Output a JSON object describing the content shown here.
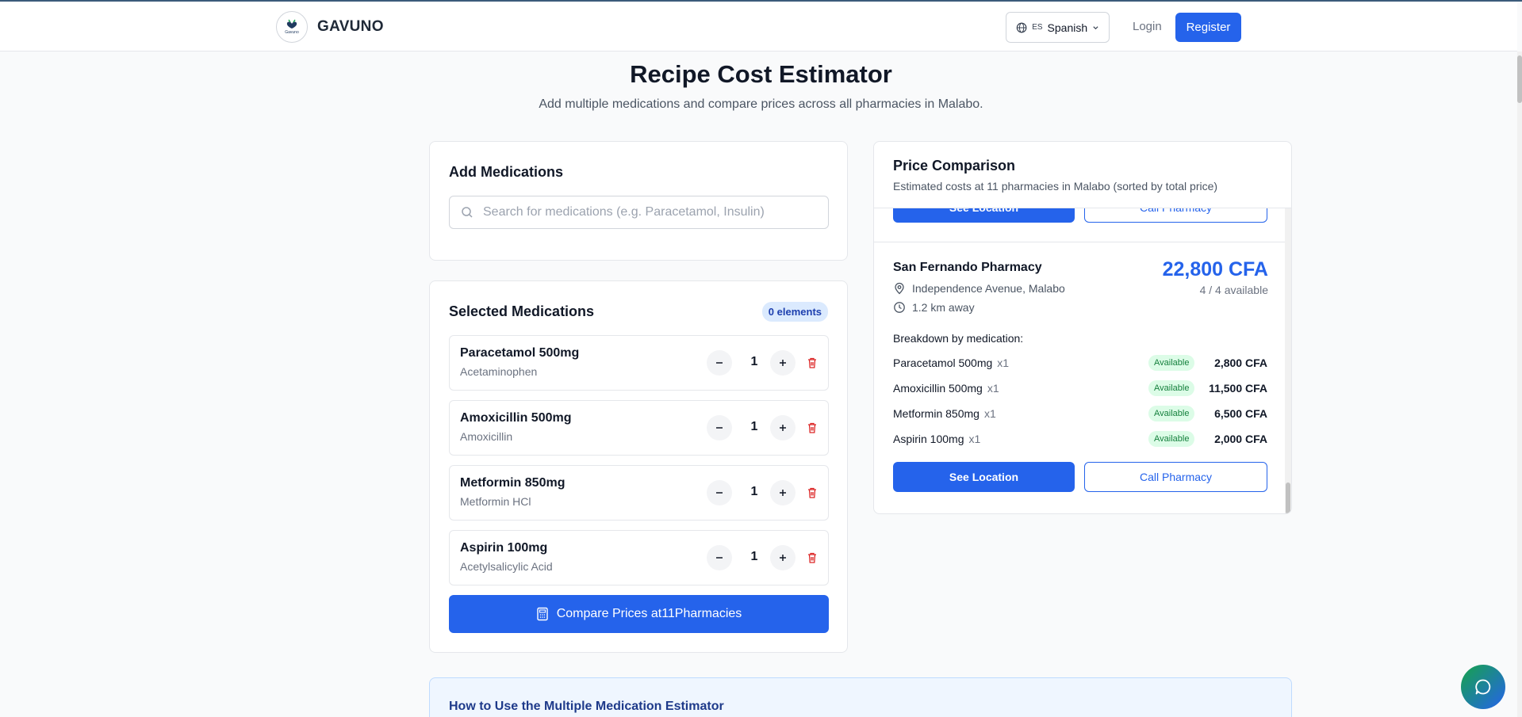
{
  "header": {
    "brand": "GAVUNO",
    "logo_text": "Gavuno",
    "language": {
      "code": "ES",
      "label": "Spanish"
    },
    "login_label": "Login",
    "register_label": "Register"
  },
  "page": {
    "title": "Recipe Cost Estimator",
    "subtitle": "Add multiple medications and compare prices across all pharmacies in Malabo."
  },
  "add_medications": {
    "heading": "Add Medications",
    "search_placeholder": "Search for medications (e.g. Paracetamol, Insulin)"
  },
  "selected_medications": {
    "heading": "Selected Medications",
    "count_badge": "0 elements",
    "items": [
      {
        "name": "Paracetamol 500mg",
        "generic": "Acetaminophen",
        "quantity": "1"
      },
      {
        "name": "Amoxicillin 500mg",
        "generic": "Amoxicillin",
        "quantity": "1"
      },
      {
        "name": "Metformin 850mg",
        "generic": "Metformin HCl",
        "quantity": "1"
      },
      {
        "name": "Aspirin 100mg",
        "generic": "Acetylsalicylic Acid",
        "quantity": "1"
      }
    ],
    "compare_label": "Compare Prices at11Pharmacies"
  },
  "price_comparison": {
    "heading": "Price Comparison",
    "subtitle": "Estimated costs at 11 pharmacies in Malabo (sorted by total price)",
    "prev_card": {
      "location_label": "See Location",
      "call_label": "Call Pharmacy"
    },
    "pharmacy": {
      "name": "San Fernando Pharmacy",
      "address": "Independence Avenue, Malabo",
      "distance": "1.2 km away",
      "total": "22,800 CFA",
      "availability": "4 / 4 available",
      "breakdown_label": "Breakdown by medication:",
      "breakdown": [
        {
          "name": "Paracetamol 500mg",
          "qty": "x1",
          "status": "Available",
          "price": "2,800 CFA"
        },
        {
          "name": "Amoxicillin 500mg",
          "qty": "x1",
          "status": "Available",
          "price": "11,500 CFA"
        },
        {
          "name": "Metformin 850mg",
          "qty": "x1",
          "status": "Available",
          "price": "6,500 CFA"
        },
        {
          "name": "Aspirin 100mg",
          "qty": "x1",
          "status": "Available",
          "price": "2,000 CFA"
        }
      ],
      "location_label": "See Location",
      "call_label": "Call Pharmacy"
    }
  },
  "howto": {
    "title": "How to Use the Multiple Medication Estimator"
  },
  "colors": {
    "primary": "#2563eb",
    "available_bg": "#dcfce7",
    "available_text": "#15803d",
    "delete": "#dc2626"
  },
  "icons": [
    "globe-icon",
    "chevron-down-icon",
    "search-icon",
    "minus-icon",
    "plus-icon",
    "trash-icon",
    "calculator-icon",
    "map-pin-icon",
    "clock-icon",
    "chat-icon"
  ]
}
